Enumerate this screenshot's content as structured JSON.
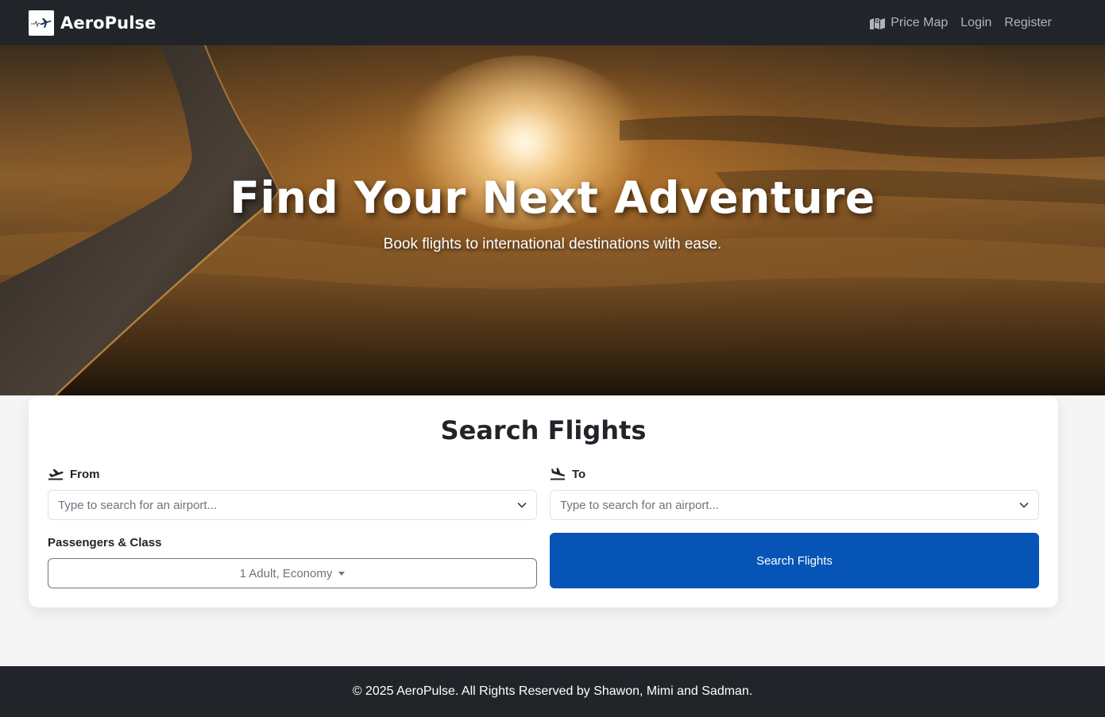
{
  "nav": {
    "brand": "AeroPulse",
    "links": [
      {
        "label": "Price Map",
        "icon": "map-icon"
      },
      {
        "label": "Login"
      },
      {
        "label": "Register"
      }
    ]
  },
  "hero": {
    "title": "Find Your Next Adventure",
    "subtitle": "Book flights to international destinations with ease."
  },
  "search": {
    "title": "Search Flights",
    "from": {
      "label": "From",
      "icon": "plane-departure-icon",
      "placeholder": "Type to search for an airport..."
    },
    "to": {
      "label": "To",
      "icon": "plane-arrival-icon",
      "placeholder": "Type to search for an airport..."
    },
    "passengers": {
      "label": "Passengers & Class",
      "value": "1 Adult, Economy"
    },
    "submit_label": "Search Flights"
  },
  "footer": {
    "text": "© 2025 AeroPulse. All Rights Reserved by Shawon, Mimi and Sadman."
  },
  "colors": {
    "nav_bg": "#212529",
    "primary": "#0654b6",
    "page_bg": "#f4f5f4"
  }
}
